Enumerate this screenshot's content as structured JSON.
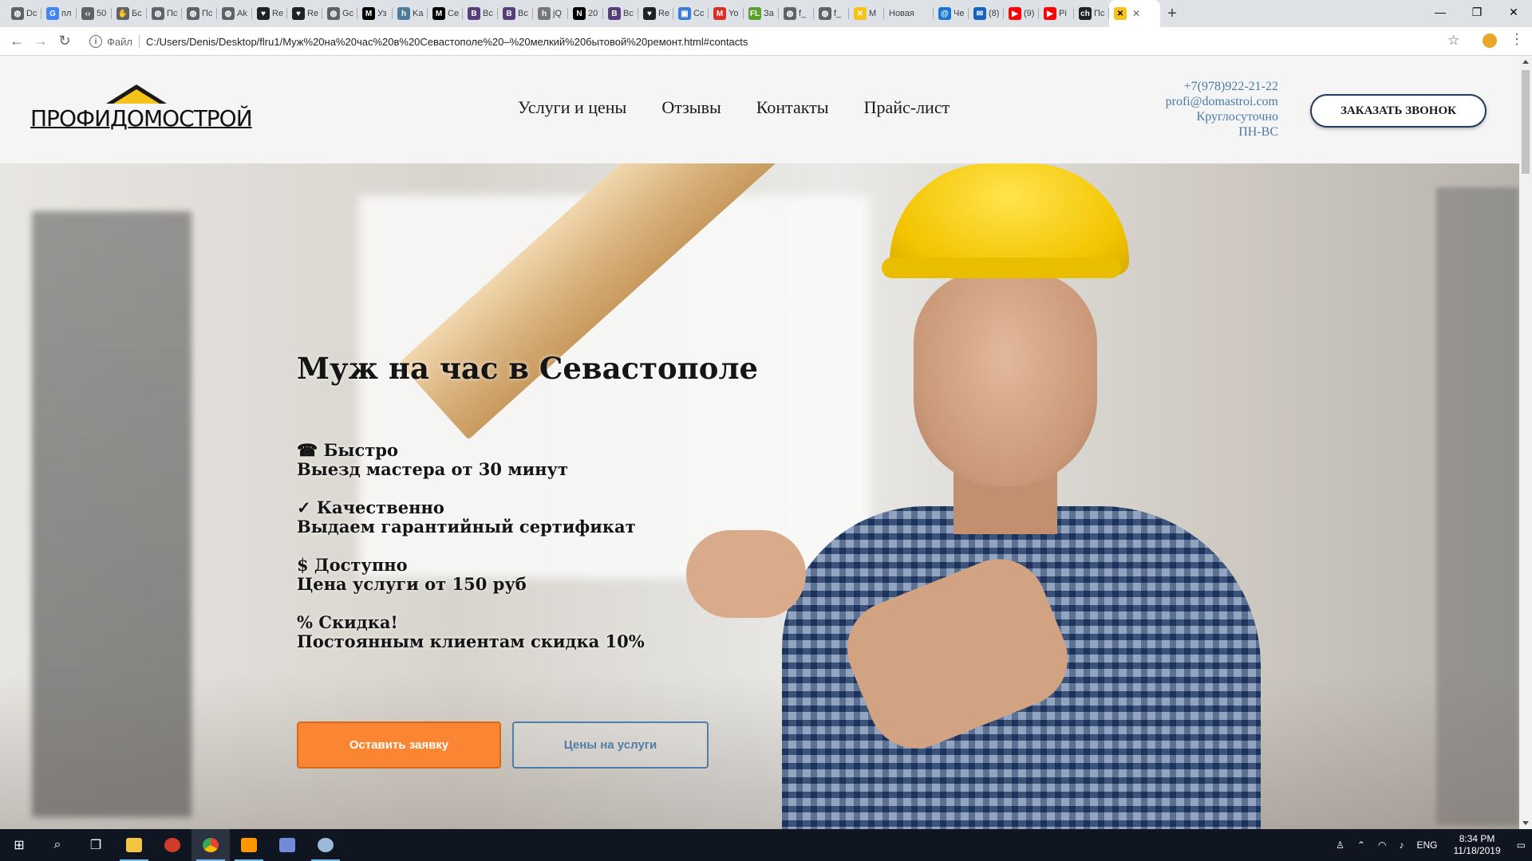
{
  "browser": {
    "tabs": [
      {
        "label": "Dc",
        "icon": "globe-icon",
        "color": "#5f6368"
      },
      {
        "label": "пл",
        "icon": "google-icon",
        "color": "#4285f4"
      },
      {
        "label": "50",
        "icon": "code-icon",
        "color": "#5f6368"
      },
      {
        "label": "Бс",
        "icon": "hand-icon",
        "color": "#5f6368"
      },
      {
        "label": "Пс",
        "icon": "globe-icon",
        "color": "#5f6368"
      },
      {
        "label": "Пс",
        "icon": "globe-icon",
        "color": "#5f6368"
      },
      {
        "label": "Ak",
        "icon": "globe-icon",
        "color": "#5f6368"
      },
      {
        "label": "Re",
        "icon": "heart-icon",
        "color": "#202124"
      },
      {
        "label": "Re",
        "icon": "heart-icon",
        "color": "#202124"
      },
      {
        "label": "Gc",
        "icon": "globe-icon",
        "color": "#5f6368"
      },
      {
        "label": "Уз",
        "icon": "m-icon",
        "color": "#000000"
      },
      {
        "label": "Ka",
        "icon": "h-icon",
        "color": "#4c7b9c"
      },
      {
        "label": "Ce",
        "icon": "m-icon",
        "color": "#000000"
      },
      {
        "label": "Bc",
        "icon": "b-icon",
        "color": "#563d7c"
      },
      {
        "label": "Bc",
        "icon": "b-icon",
        "color": "#563d7c"
      },
      {
        "label": "jQ",
        "icon": "h-icon",
        "color": "#777777"
      },
      {
        "label": "20",
        "icon": "n-icon",
        "color": "#000000"
      },
      {
        "label": "Bc",
        "icon": "b-icon",
        "color": "#563d7c"
      },
      {
        "label": "Re",
        "icon": "heart-icon",
        "color": "#202124"
      },
      {
        "label": "Cc",
        "icon": "chat-icon",
        "color": "#3a7bd5"
      },
      {
        "label": "Yo",
        "icon": "gmail-icon",
        "color": "#d93025"
      },
      {
        "label": "За",
        "icon": "fl-icon",
        "color": "#5aa02c"
      },
      {
        "label": "f_",
        "icon": "globe-icon",
        "color": "#5f6368"
      },
      {
        "label": "f_",
        "icon": "globe-icon",
        "color": "#5f6368"
      },
      {
        "label": "M",
        "icon": "raiffeisen-icon",
        "color": "#f6c31a"
      },
      {
        "label": "Новая",
        "icon": "none",
        "color": "#dee1e6"
      },
      {
        "label": "Че",
        "icon": "at-icon",
        "color": "#1976d2"
      },
      {
        "label": "(8)",
        "icon": "mail-icon",
        "color": "#1565c0"
      },
      {
        "label": "(9)",
        "icon": "youtube-icon",
        "color": "#ff0000"
      },
      {
        "label": "Pi",
        "icon": "youtube-icon",
        "color": "#ff0000"
      },
      {
        "label": "Пс",
        "icon": "ch-icon",
        "color": "#202124"
      }
    ],
    "active_tab": {
      "icon": "raiffeisen-icon",
      "close": "✕"
    },
    "new_tab": "+",
    "window_controls": {
      "minimize": "—",
      "maximize": "❐",
      "close": "✕"
    },
    "address": {
      "scheme": "Файл",
      "url": "C:/Users/Denis/Desktop/flru1/Муж%20на%20час%20в%20Севастополе%20–%20мелкий%20бытовой%20ремонт.html#contacts"
    }
  },
  "site": {
    "logo_text": "ПРОФИДОМОСТРОЙ",
    "nav": [
      "Услуги и цены",
      "Отзывы",
      "Контакты",
      "Прайс-лист"
    ],
    "contacts": {
      "phone": "+7(978)922-21-22",
      "email": "profi@domastroi.com",
      "hours": "Круглосуточно",
      "days": "ПН-ВС"
    },
    "callback_button": "ЗАКАЗАТЬ ЗВОНОК",
    "hero": {
      "title": "Муж на час в Севастополе",
      "features": [
        {
          "head": "☎ Быстро",
          "text": "Выезд мастера от 30 минут"
        },
        {
          "head": "✓ Качественно",
          "text": "Выдаем гарантийный сертификат"
        },
        {
          "head": "$ Доступно",
          "text": "Цена услуги от 150 руб"
        },
        {
          "head": "% Скидка!",
          "text": "Постоянным клиентам скидка 10%"
        }
      ],
      "primary_button": "Оставить заявку",
      "secondary_button": "Цены на услуги"
    }
  },
  "taskbar": {
    "lang": "ENG",
    "time": "8:34 PM",
    "date": "11/18/2019"
  }
}
